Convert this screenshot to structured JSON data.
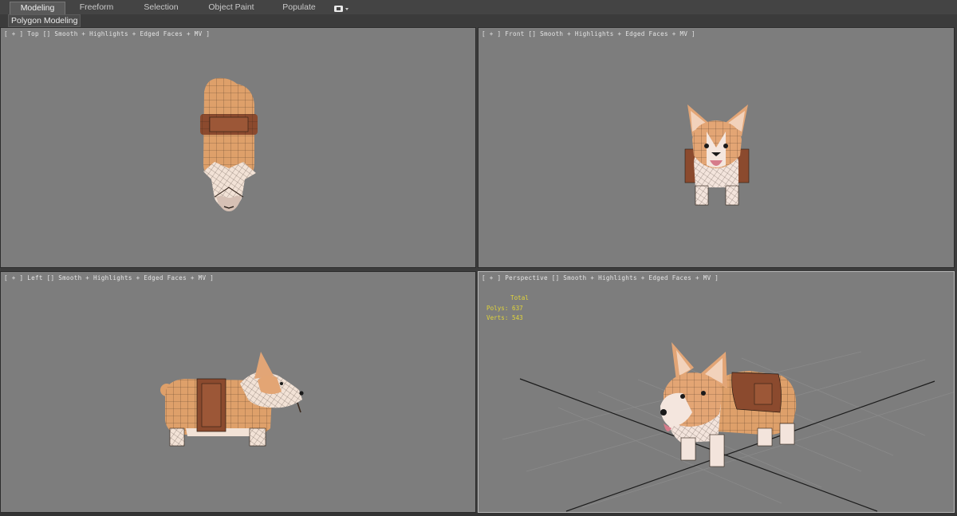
{
  "ribbon": {
    "tabs": [
      {
        "label": "Modeling",
        "active": true
      },
      {
        "label": "Freeform"
      },
      {
        "label": "Selection"
      },
      {
        "label": "Object Paint"
      },
      {
        "label": "Populate"
      }
    ]
  },
  "subribbon": {
    "label": "Polygon Modeling"
  },
  "viewports": {
    "top": {
      "label": "[ + ] Top [] Smooth + Highlights + Edged Faces + MV ]"
    },
    "front": {
      "label": "[ + ] Front [] Smooth + Highlights + Edged Faces + MV ]"
    },
    "left": {
      "label": "[ + ] Left [] Smooth + Highlights + Edged Faces + MV ]"
    },
    "perspective": {
      "label": "[ + ] Perspective [] Smooth + Highlights + Edged Faces + MV ]",
      "stats": {
        "header": "Total",
        "polys_label": "Polys:",
        "polys_value": "637",
        "verts_label": "Verts:",
        "verts_value": "543"
      }
    }
  },
  "colors": {
    "viewport_bg": "#7d7d7d",
    "fur_orange": "#e0a06a",
    "fur_white": "#f4e4da",
    "strap_brown": "#8a4b30",
    "stats_yellow": "#e0d43a"
  }
}
